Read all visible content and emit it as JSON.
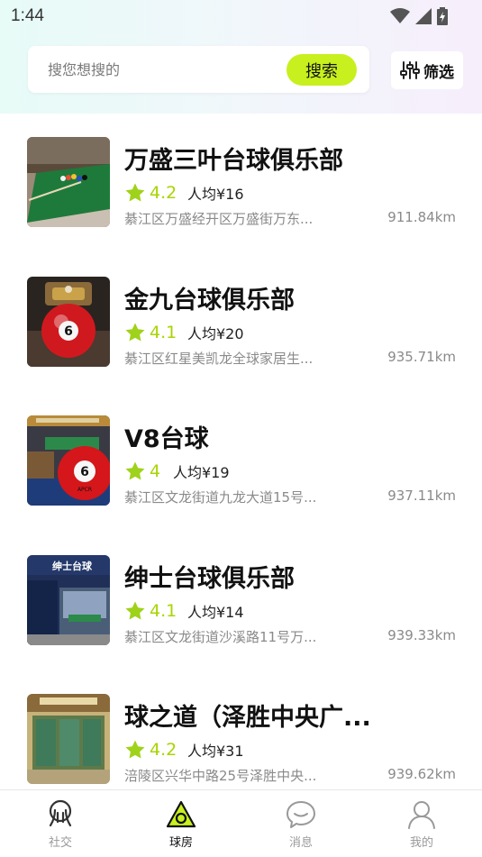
{
  "status_bar": {
    "time": "1:44"
  },
  "search": {
    "placeholder": "搜您想搜的",
    "button_label": "搜索"
  },
  "filter": {
    "label": "筛选"
  },
  "venues": [
    {
      "name": "万盛三叶台球俱乐部",
      "rating": "4.2",
      "price": "人均¥16",
      "address": "綦江区万盛经开区万盛街万东...",
      "distance": "911.84km"
    },
    {
      "name": "金九台球俱乐部",
      "rating": "4.1",
      "price": "人均¥20",
      "address": "綦江区红星美凯龙全球家居生...",
      "distance": "935.71km"
    },
    {
      "name": "V8台球",
      "rating": "4",
      "price": "人均¥19",
      "address": "綦江区文龙街道九龙大道15号...",
      "distance": "937.11km"
    },
    {
      "name": "绅士台球俱乐部",
      "rating": "4.1",
      "price": "人均¥14",
      "address": "綦江区文龙街道沙溪路11号万...",
      "distance": "939.33km"
    },
    {
      "name": "球之道（泽胜中央广...",
      "rating": "4.2",
      "price": "人均¥31",
      "address": "涪陵区兴华中路25号泽胜中央...",
      "distance": "939.62km"
    }
  ],
  "thumbnail_text": {
    "ball_number": "6",
    "ball_brand": "APCR",
    "sign_text": "绅士台球"
  },
  "tabs": [
    {
      "label": "社交",
      "icon": "social-icon",
      "active": false
    },
    {
      "label": "球房",
      "icon": "billiard-room-icon",
      "active": true
    },
    {
      "label": "消息",
      "icon": "message-icon",
      "active": false
    },
    {
      "label": "我的",
      "icon": "profile-icon",
      "active": false
    }
  ],
  "colors": {
    "accent": "#c8f01e",
    "star": "#9fd21b",
    "rating_text": "#a8d400",
    "secondary_text": "#8a8a8a"
  }
}
